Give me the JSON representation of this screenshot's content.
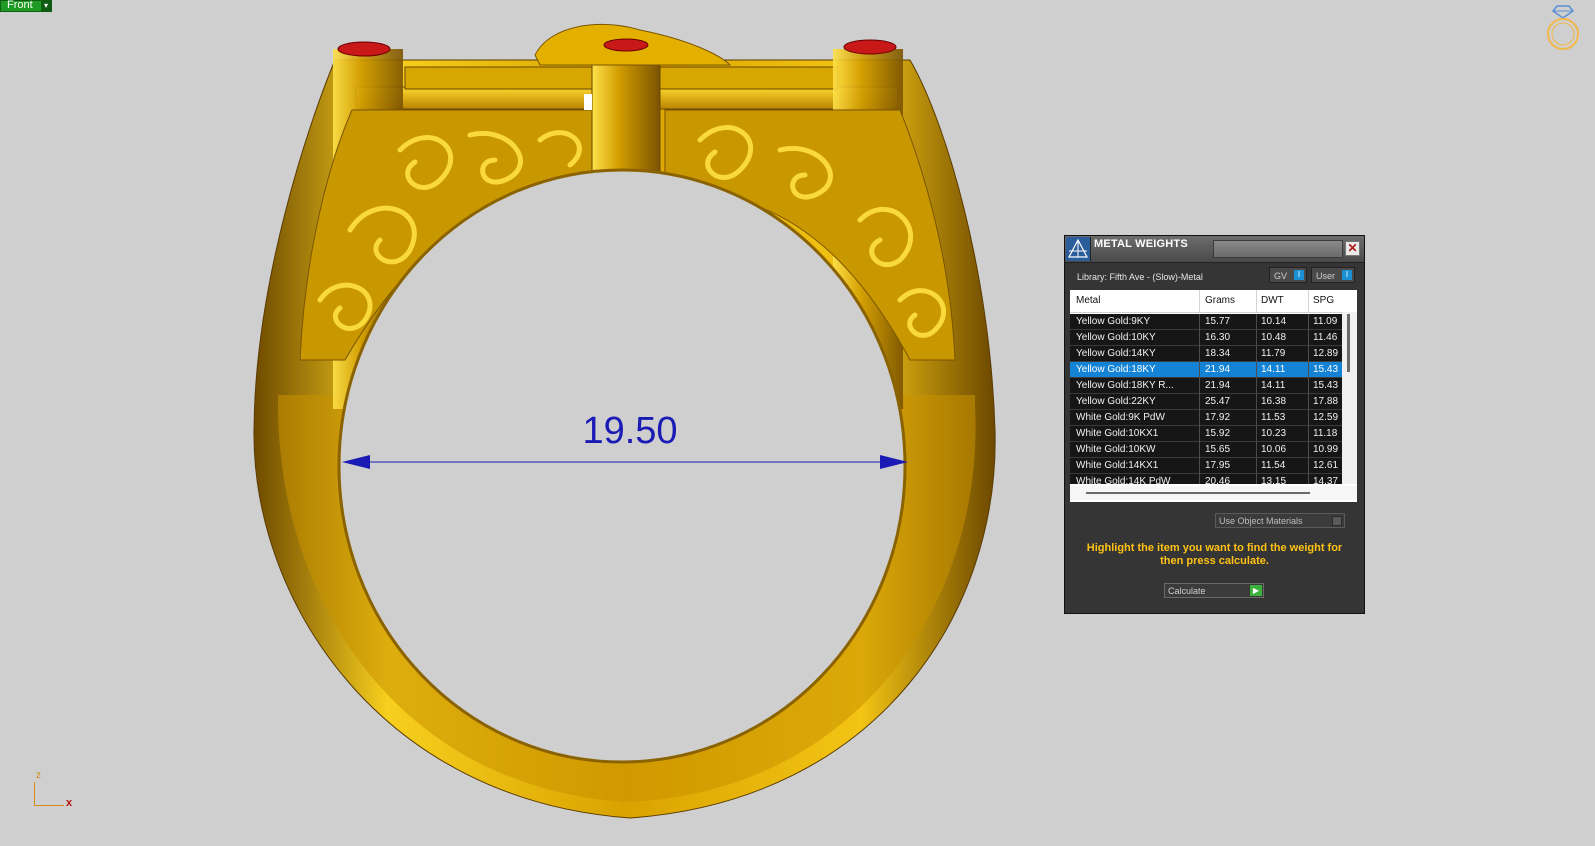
{
  "viewport": {
    "view_tab": {
      "label": "Front",
      "arrow": "▾"
    },
    "dimension_value": "19.50",
    "axis": {
      "z": "z",
      "x": "x"
    }
  },
  "panel": {
    "title": "METAL WEIGHTS",
    "close": "✕",
    "library": "Library: Fifth Ave - (Slow)-Metal",
    "toggles": [
      {
        "label": "GV",
        "indicator": "I"
      },
      {
        "label": "User",
        "indicator": "I"
      }
    ],
    "columns": [
      "Metal",
      "Grams",
      "DWT",
      "SPG"
    ],
    "rows": [
      {
        "metal": "Yellow Gold:9KY",
        "grams": "15.77",
        "dwt": "10.14",
        "spg": "11.09"
      },
      {
        "metal": "Yellow Gold:10KY",
        "grams": "16.30",
        "dwt": "10.48",
        "spg": "11.46"
      },
      {
        "metal": "Yellow Gold:14KY",
        "grams": "18.34",
        "dwt": "11.79",
        "spg": "12.89"
      },
      {
        "metal": "Yellow Gold:18KY",
        "grams": "21.94",
        "dwt": "14.11",
        "spg": "15.43"
      },
      {
        "metal": "Yellow Gold:18KY R...",
        "grams": "21.94",
        "dwt": "14.11",
        "spg": "15.43"
      },
      {
        "metal": "Yellow Gold:22KY",
        "grams": "25.47",
        "dwt": "16.38",
        "spg": "17.88"
      },
      {
        "metal": "White Gold:9K PdW",
        "grams": "17.92",
        "dwt": "11.53",
        "spg": "12.59"
      },
      {
        "metal": "White Gold:10KX1",
        "grams": "15.92",
        "dwt": "10.23",
        "spg": "11.18"
      },
      {
        "metal": "White Gold:10KW",
        "grams": "15.65",
        "dwt": "10.06",
        "spg": "10.99"
      },
      {
        "metal": "White Gold:14KX1",
        "grams": "17.95",
        "dwt": "11.54",
        "spg": "12.61"
      },
      {
        "metal": "White Gold:14K PdW",
        "grams": "20.46",
        "dwt": "13.15",
        "spg": "14.37"
      }
    ],
    "selected_index": 3,
    "use_object_materials": "Use Object Materials",
    "hint": "Highlight the item you want to find the weight for then press calculate.",
    "calculate": "Calculate",
    "calculate_icon": "▶"
  },
  "colors": {
    "background": "#cfcfcf",
    "gold": "#e8b800",
    "dimension": "#1a1ab4",
    "selection": "#1483d6",
    "hint": "#ffc214"
  },
  "icons": [
    "ring-diamond-icon",
    "scale-icon",
    "close-icon"
  ]
}
